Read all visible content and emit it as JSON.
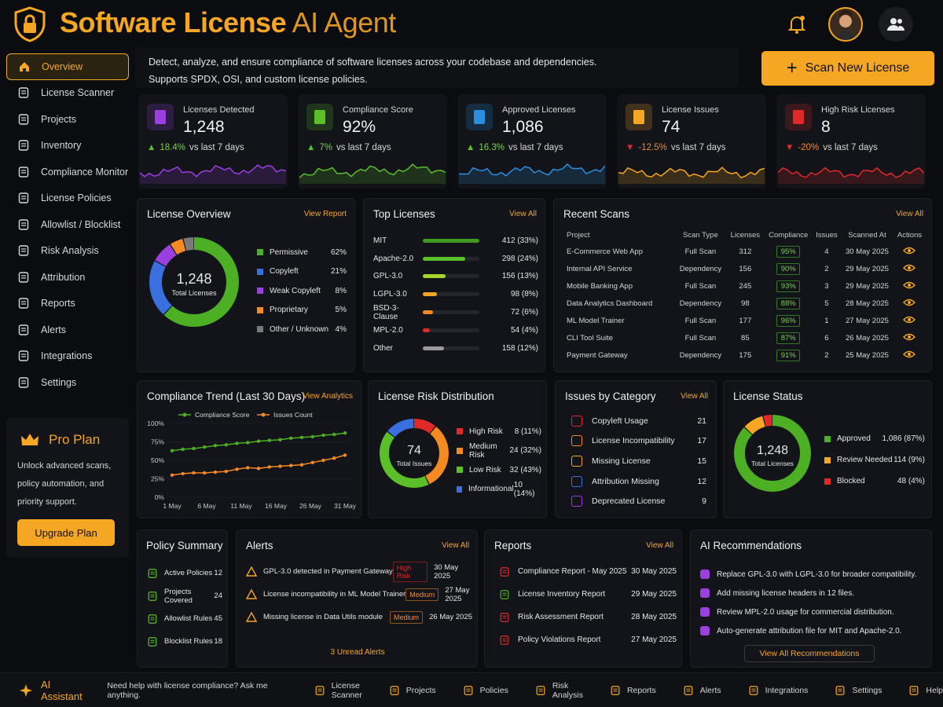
{
  "header": {
    "title_bold": "Software License",
    "title_light": "AI Agent"
  },
  "intro": {
    "line1": "Detect, analyze, and ensure compliance of software licenses across your codebase and dependencies.",
    "line2": "Supports SPDX, OSI, and custom license policies."
  },
  "scan_button": "Scan New License",
  "sidebar": {
    "items": [
      {
        "label": "Overview",
        "icon": "home-icon"
      },
      {
        "label": "License Scanner",
        "icon": "scanner-icon"
      },
      {
        "label": "Projects",
        "icon": "projects-icon"
      },
      {
        "label": "Inventory",
        "icon": "inventory-icon"
      },
      {
        "label": "Compliance Monitor",
        "icon": "monitor-icon"
      },
      {
        "label": "License Policies",
        "icon": "policy-icon"
      },
      {
        "label": "Allowlist / Blocklist",
        "icon": "allowlist-icon"
      },
      {
        "label": "Risk Analysis",
        "icon": "risk-icon"
      },
      {
        "label": "Attribution",
        "icon": "attribution-icon"
      },
      {
        "label": "Reports",
        "icon": "reports-icon"
      },
      {
        "label": "Alerts",
        "icon": "bell-icon"
      },
      {
        "label": "Integrations",
        "icon": "integrations-icon"
      },
      {
        "label": "Settings",
        "icon": "gear-icon"
      }
    ]
  },
  "pro": {
    "title": "Pro Plan",
    "desc1": "Unlock advanced scans,",
    "desc2": "policy automation, and",
    "desc3": "priority support.",
    "button": "Upgrade Plan"
  },
  "kpis": [
    {
      "label": "Licenses Detected",
      "value": "1,248",
      "arrow": "▲",
      "change": "18.4%",
      "suffix": "vs last 7 days",
      "color": "#9b3fe0"
    },
    {
      "label": "Compliance Score",
      "value": "92%",
      "arrow": "▲",
      "change": "7%",
      "suffix": "vs last 7 days",
      "color": "#5bbf2a"
    },
    {
      "label": "Approved Licenses",
      "value": "1,086",
      "arrow": "▲",
      "change": "16.3%",
      "suffix": "vs last 7 days",
      "color": "#2a8fe0"
    },
    {
      "label": "License Issues",
      "value": "74",
      "arrow": "▼",
      "change": "-12.5%",
      "suffix": "vs last 7 days",
      "color": "#f5a623"
    },
    {
      "label": "High Risk Licenses",
      "value": "8",
      "arrow": "▼",
      "change": "-20%",
      "suffix": "vs last 7 days",
      "color": "#e02a2a"
    }
  ],
  "license_overview": {
    "title": "License Overview",
    "link": "View Report",
    "center_value": "1,248",
    "center_label": "Total Licenses",
    "items": [
      {
        "label": "Permissive",
        "value": "62%",
        "pct": 62,
        "color": "#4caf24"
      },
      {
        "label": "Copyleft",
        "value": "21%",
        "pct": 21,
        "color": "#3a6fe0"
      },
      {
        "label": "Weak Copyleft",
        "value": "8%",
        "pct": 8,
        "color": "#9b3fe0"
      },
      {
        "label": "Proprietary",
        "value": "5%",
        "pct": 5,
        "color": "#f58a23"
      },
      {
        "label": "Other / Unknown",
        "value": "4%",
        "pct": 4,
        "color": "#7a7a7a"
      }
    ]
  },
  "top_licenses": {
    "title": "Top Licenses",
    "link": "View All",
    "items": [
      {
        "name": "MIT",
        "value": "412 (33%)",
        "pct": 33,
        "color": "#3f9a22"
      },
      {
        "name": "Apache-2.0",
        "value": "298 (24%)",
        "pct": 24,
        "color": "#5bbf2a"
      },
      {
        "name": "GPL-3.0",
        "value": "156 (13%)",
        "pct": 13,
        "color": "#a6d62a"
      },
      {
        "name": "LGPL-3.0",
        "value": "98 (8%)",
        "pct": 8,
        "color": "#f5a623"
      },
      {
        "name": "BSD-3-Clause",
        "value": "72 (6%)",
        "pct": 6,
        "color": "#f58a23"
      },
      {
        "name": "MPL-2.0",
        "value": "54 (4%)",
        "pct": 4,
        "color": "#e02a2a"
      },
      {
        "name": "Other",
        "value": "158 (12%)",
        "pct": 12,
        "color": "#9a9a9a"
      }
    ]
  },
  "recent_scans": {
    "title": "Recent Scans",
    "link": "View All",
    "headers": [
      "Project",
      "Scan Type",
      "Licenses",
      "Compliance",
      "Issues",
      "Scanned At",
      "Actions"
    ],
    "rows": [
      [
        "E-Commerce Web App",
        "Full Scan",
        "312",
        "95%",
        "4",
        "30 May 2025"
      ],
      [
        "Internal API Service",
        "Dependency",
        "156",
        "90%",
        "2",
        "29 May 2025"
      ],
      [
        "Mobile Banking App",
        "Full Scan",
        "245",
        "93%",
        "3",
        "29 May 2025"
      ],
      [
        "Data Analytics Dashboard",
        "Dependency",
        "98",
        "88%",
        "5",
        "28 May 2025"
      ],
      [
        "ML Model Trainer",
        "Full Scan",
        "177",
        "96%",
        "1",
        "27 May 2025"
      ],
      [
        "CLI Tool Suite",
        "Full Scan",
        "85",
        "87%",
        "6",
        "26 May 2025"
      ],
      [
        "Payment Gateway",
        "Dependency",
        "175",
        "91%",
        "2",
        "25 May 2025"
      ]
    ]
  },
  "compliance_trend": {
    "title": "Compliance Trend (Last 30 Days)",
    "link": "View Analytics"
  },
  "chart_data": {
    "type": "line",
    "categories": [
      "1 May",
      "6 May",
      "11 May",
      "16 May",
      "26 May",
      "31 May"
    ],
    "ylim": [
      0,
      100
    ],
    "yticks": [
      "100%",
      "75%",
      "50%",
      "25%",
      "0%"
    ],
    "series": [
      {
        "name": "Compliance Score",
        "color": "#4caf24",
        "values": [
          63,
          65,
          66,
          68,
          70,
          71,
          73,
          74,
          76,
          77,
          78,
          80,
          81,
          82,
          84,
          85,
          87
        ]
      },
      {
        "name": "Issues Count",
        "color": "#f58a23",
        "values": [
          30,
          32,
          33,
          33,
          34,
          35,
          38,
          40,
          39,
          41,
          42,
          43,
          44,
          47,
          50,
          53,
          57
        ]
      }
    ]
  },
  "risk_dist": {
    "title": "License Risk Distribution",
    "center_value": "74",
    "center_label": "Total Issues",
    "items": [
      {
        "label": "High Risk",
        "value": "8 (11%)",
        "pct": 11,
        "color": "#e02a2a"
      },
      {
        "label": "Medium Risk",
        "value": "24 (32%)",
        "pct": 32,
        "color": "#f58a23"
      },
      {
        "label": "Low Risk",
        "value": "32 (43%)",
        "pct": 43,
        "color": "#5bbf2a"
      },
      {
        "label": "Informational",
        "value": "10 (14%)",
        "pct": 14,
        "color": "#3a6fe0"
      }
    ]
  },
  "issues_cat": {
    "title": "Issues by Category",
    "link": "View All",
    "items": [
      {
        "label": "Copyleft Usage",
        "value": "21",
        "color": "#e02a2a",
        "icon": "copyleft-icon"
      },
      {
        "label": "License Incompatibility",
        "value": "17",
        "color": "#f58a23",
        "icon": "incompat-icon"
      },
      {
        "label": "Missing License",
        "value": "15",
        "color": "#f5a623",
        "icon": "missing-icon"
      },
      {
        "label": "Attribution Missing",
        "value": "12",
        "color": "#3a6fe0",
        "icon": "attribution-icon"
      },
      {
        "label": "Deprecated License",
        "value": "9",
        "color": "#9b3fe0",
        "icon": "deprecated-icon"
      }
    ]
  },
  "license_status": {
    "title": "License Status",
    "center_value": "1,248",
    "center_label": "Total Licenses",
    "items": [
      {
        "label": "Approved",
        "value": "1,086 (87%)",
        "pct": 87,
        "color": "#4caf24"
      },
      {
        "label": "Review Needed",
        "value": "114 (9%)",
        "pct": 9,
        "color": "#f5a623"
      },
      {
        "label": "Blocked",
        "value": "48 (4%)",
        "pct": 4,
        "color": "#e02a2a"
      }
    ]
  },
  "policy": {
    "title": "Policy Summary",
    "items": [
      {
        "label": "Active Policies",
        "value": "12"
      },
      {
        "label": "Projects Covered",
        "value": "24"
      },
      {
        "label": "Allowlist Rules",
        "value": "45"
      },
      {
        "label": "Blocklist Rules",
        "value": "18"
      }
    ]
  },
  "alerts": {
    "title": "Alerts",
    "link": "View All",
    "footer": "3 Unread Alerts",
    "items": [
      {
        "text": "GPL-3.0 detected in Payment Gateway",
        "sev": "High Risk",
        "sevcolor": "#e02a2a",
        "date": "30 May 2025"
      },
      {
        "text": "License incompatibility in ML Model Trainer",
        "sev": "Medium",
        "sevcolor": "#f58a23",
        "date": "27 May 2025"
      },
      {
        "text": "Missing license in Data Utils module",
        "sev": "Medium",
        "sevcolor": "#f58a23",
        "date": "26 May 2025"
      }
    ]
  },
  "reports": {
    "title": "Reports",
    "link": "View All",
    "items": [
      {
        "label": "Compliance Report - May 2025",
        "date": "30 May 2025",
        "color": "#e02a2a"
      },
      {
        "label": "License Inventory Report",
        "date": "29 May 2025",
        "color": "#4caf24"
      },
      {
        "label": "Risk Assessment Report",
        "date": "28 May 2025",
        "color": "#e02a2a"
      },
      {
        "label": "Policy Violations Report",
        "date": "27 May 2025",
        "color": "#e02a2a"
      }
    ]
  },
  "ai_rec": {
    "title": "AI Recommendations",
    "button": "View All Recommendations",
    "items": [
      "Replace GPL-3.0 with LGPL-3.0 for broader compatibility.",
      "Add missing license headers in 12 files.",
      "Review MPL-2.0 usage for commercial distribution.",
      "Auto-generate attribution file for MIT and Apache-2.0."
    ]
  },
  "footer": {
    "assistant": "AI Assistant",
    "prompt": "Need help with license compliance? Ask me anything.",
    "items": [
      {
        "label": "License Scanner",
        "icon": "scanner-icon"
      },
      {
        "label": "Projects",
        "icon": "folder-icon"
      },
      {
        "label": "Policies",
        "icon": "policy-icon"
      },
      {
        "label": "Risk Analysis",
        "icon": "warning-icon"
      },
      {
        "label": "Reports",
        "icon": "reports-icon"
      },
      {
        "label": "Alerts",
        "icon": "bell-icon"
      },
      {
        "label": "Integrations",
        "icon": "integrations-icon"
      },
      {
        "label": "Settings",
        "icon": "gear-icon"
      },
      {
        "label": "Help",
        "icon": "help-icon"
      }
    ]
  }
}
